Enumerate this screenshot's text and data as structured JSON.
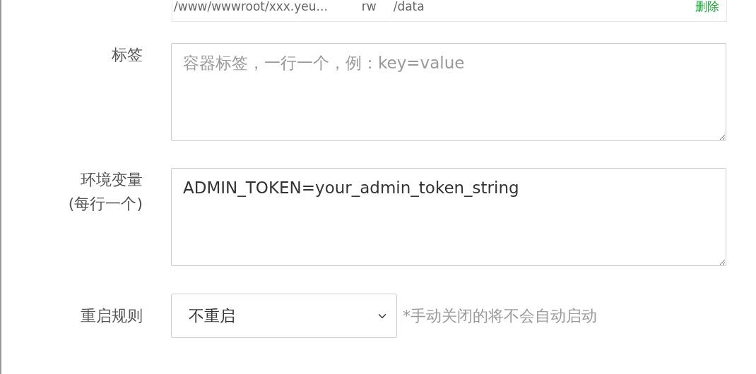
{
  "volume_row": {
    "host_path": "/www/wwwroot/xxx.yeu...",
    "mode": "rw",
    "container_path": "/data",
    "delete_link": "删除"
  },
  "labels_field": {
    "label": "标签",
    "placeholder": "容器标签，一行一个，例：key=value"
  },
  "env_field": {
    "label": "环境变量",
    "label_note": "(每行一个)",
    "value": "ADMIN_TOKEN=your_admin_token_string"
  },
  "restart_field": {
    "label": "重启规则",
    "value": "不重启",
    "hint": "*手动关闭的将不会自动启动"
  }
}
